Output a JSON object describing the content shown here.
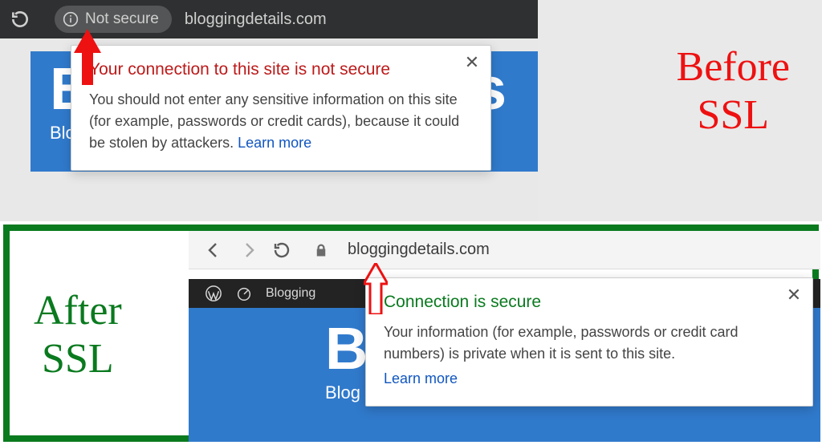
{
  "before": {
    "label": "Before\nSSL",
    "address_bar": {
      "not_secure_label": "Not secure",
      "url": "bloggingdetails.com"
    },
    "popup": {
      "title": "Your connection to this site is not secure",
      "body": "You should not enter any sensitive information on this site (for example, passwords or credit cards), because it could be stolen by attackers. ",
      "learn_more": "Learn more"
    },
    "site": {
      "title": "Bloggingdetails",
      "tagline": "Blog"
    }
  },
  "after": {
    "label": "After\nSSL",
    "address_bar": {
      "url": "bloggingdetails.com"
    },
    "wp_bar": {
      "site_name": "Blogging"
    },
    "popup": {
      "title": "Connection is secure",
      "body": "Your information (for example, passwords or credit card numbers) is private when it is sent to this site.",
      "learn_more": "Learn more"
    },
    "site": {
      "title": "Bloggingdetails",
      "tagline": "Blog"
    }
  },
  "colors": {
    "insecure": "#bd1a1a",
    "secure": "#0a7a1f",
    "link": "#1056c0",
    "banner": "#307acc"
  }
}
